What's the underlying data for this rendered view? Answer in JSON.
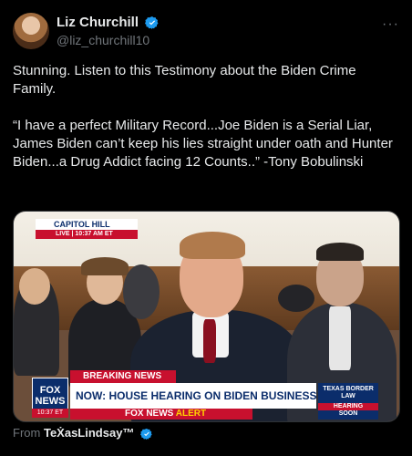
{
  "post": {
    "display_name": "Liz Churchill",
    "handle": "@liz_churchill10",
    "more_label": "···",
    "text_lines": [
      "Stunning. Listen to this Testimony about the Biden Crime Family.",
      "“I have a perfect Military Record...Joe Biden is a Serial Liar, James Biden can’t keep his lies straight under oath and Hunter Biden...a Drug Addict facing 12 Counts..” -Tony Bobulinski"
    ],
    "from_label": "From",
    "from_name": "TeẊasLindsay™"
  },
  "video": {
    "bug_top": "CAPITOL HILL",
    "bug_bottom": "LIVE | 10:37 AM ET",
    "fox_logo": "FOX NEWS",
    "fox_time": "10:37 ET",
    "breaking": "BREAKING NEWS",
    "headline": "NOW: HOUSE HEARING ON BIDEN BUSINESS DEALINGS",
    "alert_brand": "FOX NEWS",
    "alert_word": "ALERT",
    "side_title": "TEXAS BORDER LAW",
    "side_hearing": "HEARING",
    "side_soon": "SOON"
  },
  "colors": {
    "background": "#000000",
    "verified_badge": "#1d9bf0",
    "secondary_text": "#71767b",
    "fox_red": "#c8102e",
    "fox_blue": "#0b2d6b"
  },
  "icons": [
    "verified-badge-icon",
    "more-options-icon",
    "avatar-image"
  ]
}
